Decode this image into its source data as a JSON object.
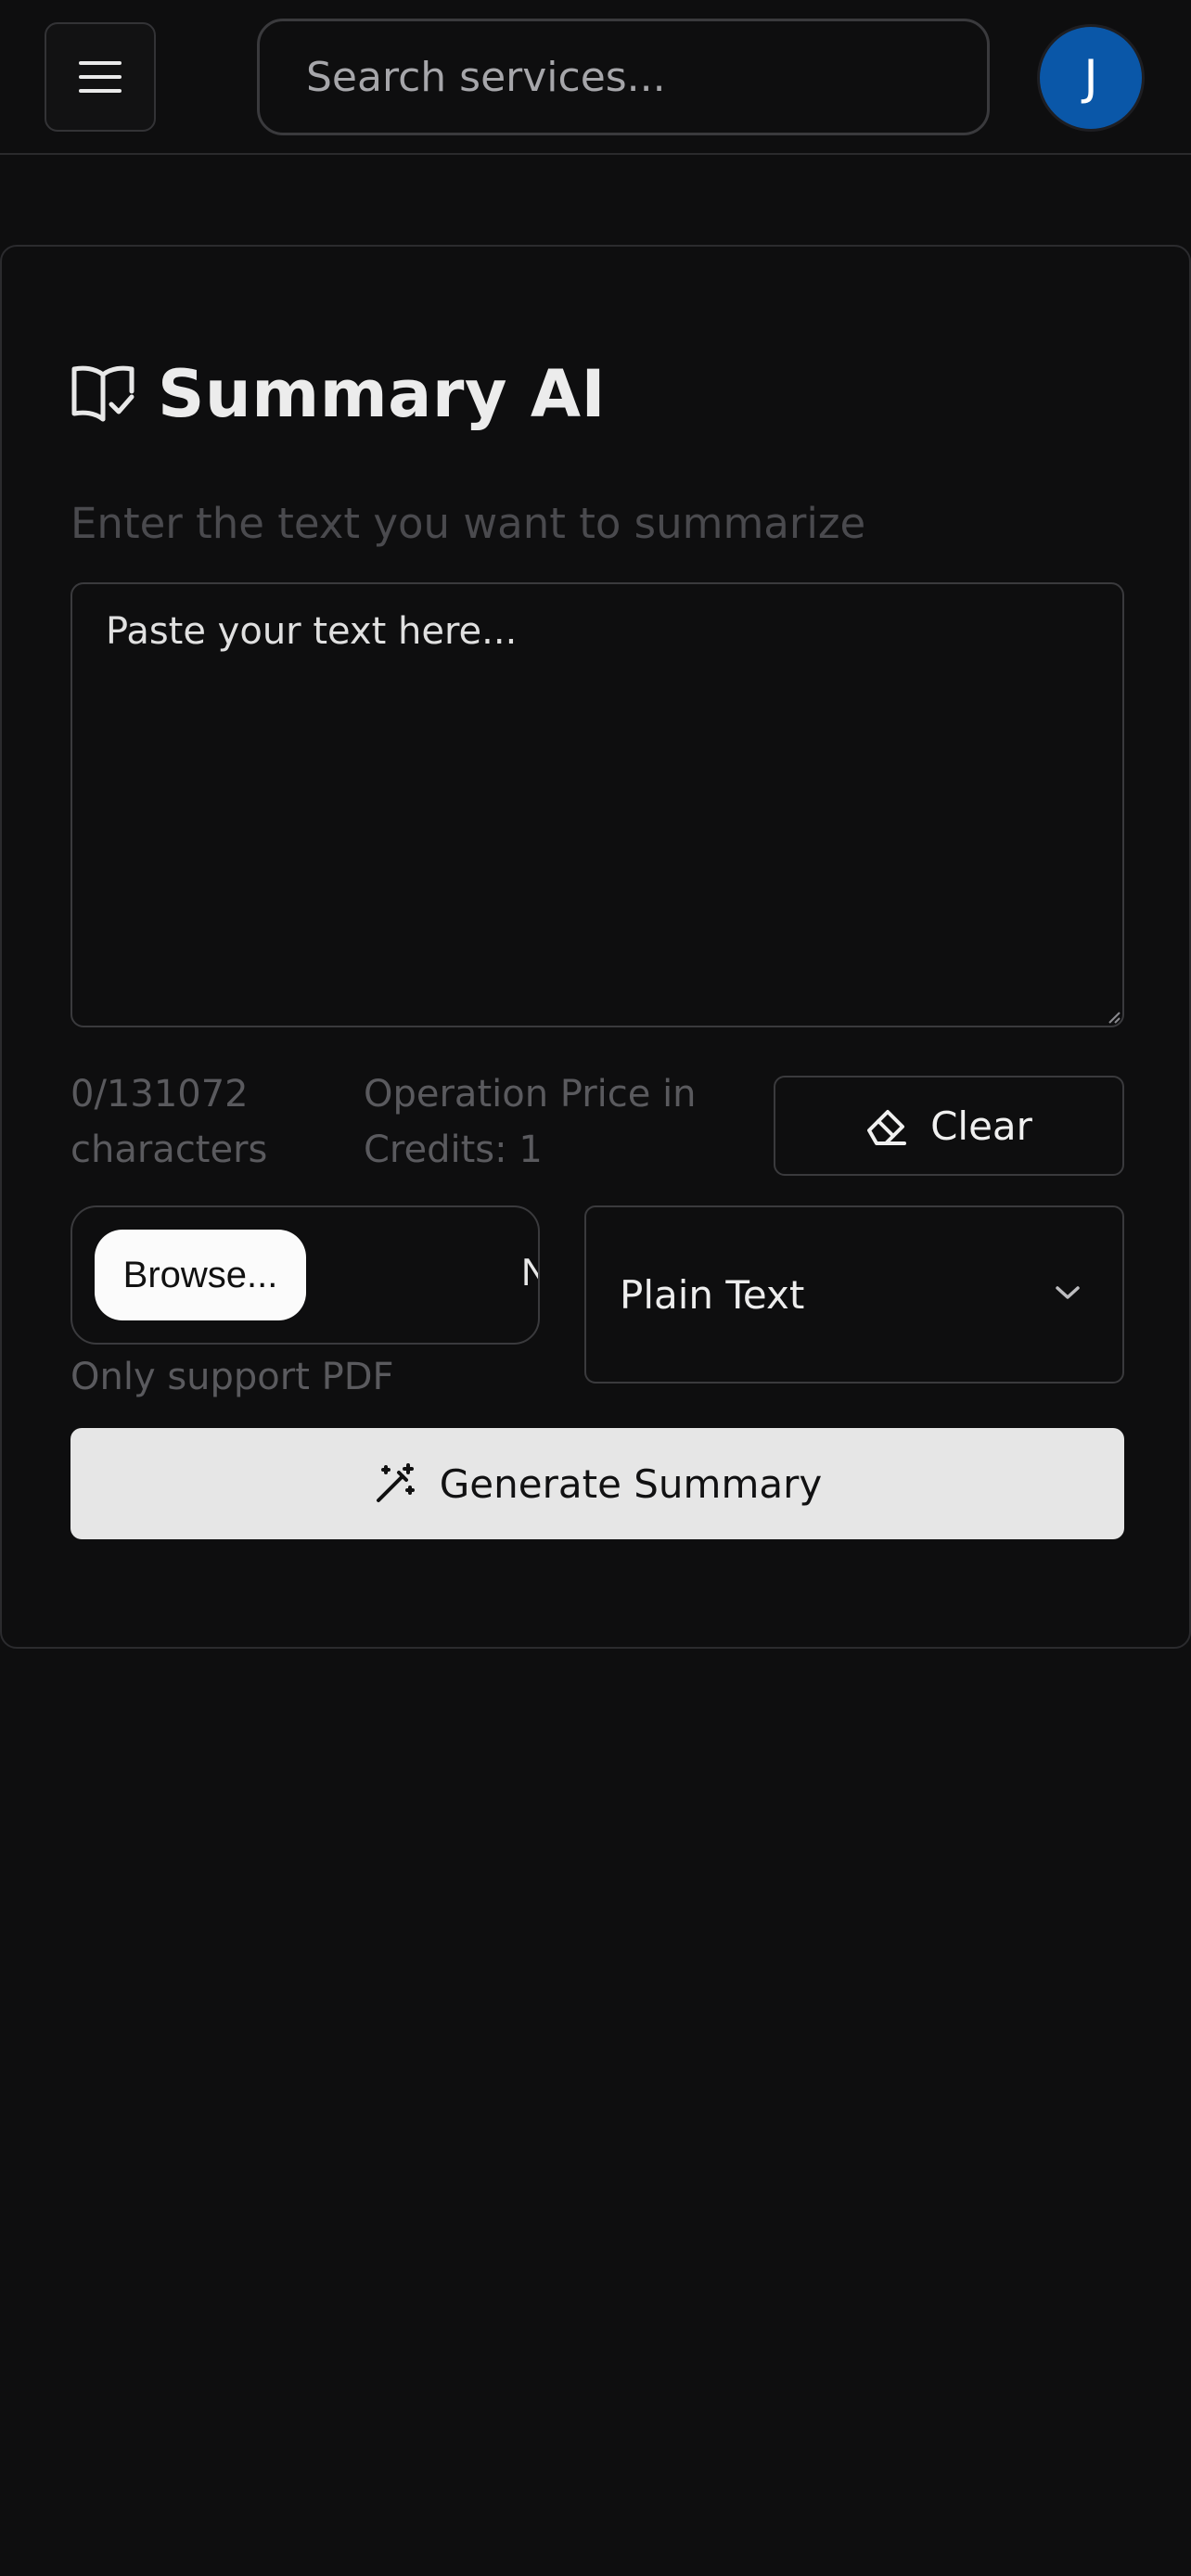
{
  "header": {
    "search_placeholder": "Search services...",
    "avatar_initial": "J"
  },
  "card": {
    "title": "Summary AI",
    "subtitle": "Enter the text you want to summarize",
    "textarea_placeholder": "Paste your text here...",
    "char_count": "0/131072 characters",
    "price": "Operation Price in Credits: 1",
    "clear_label": "Clear",
    "browse_label": "Browse...",
    "no_file_label": "No file selected.",
    "format_selected": "Plain Text",
    "pdf_note": "Only support PDF",
    "generate_label": "Generate Summary"
  },
  "colors": {
    "background": "#0e0e0f",
    "avatar": "#0a57a8",
    "primary_button": "#e6e6e6"
  }
}
